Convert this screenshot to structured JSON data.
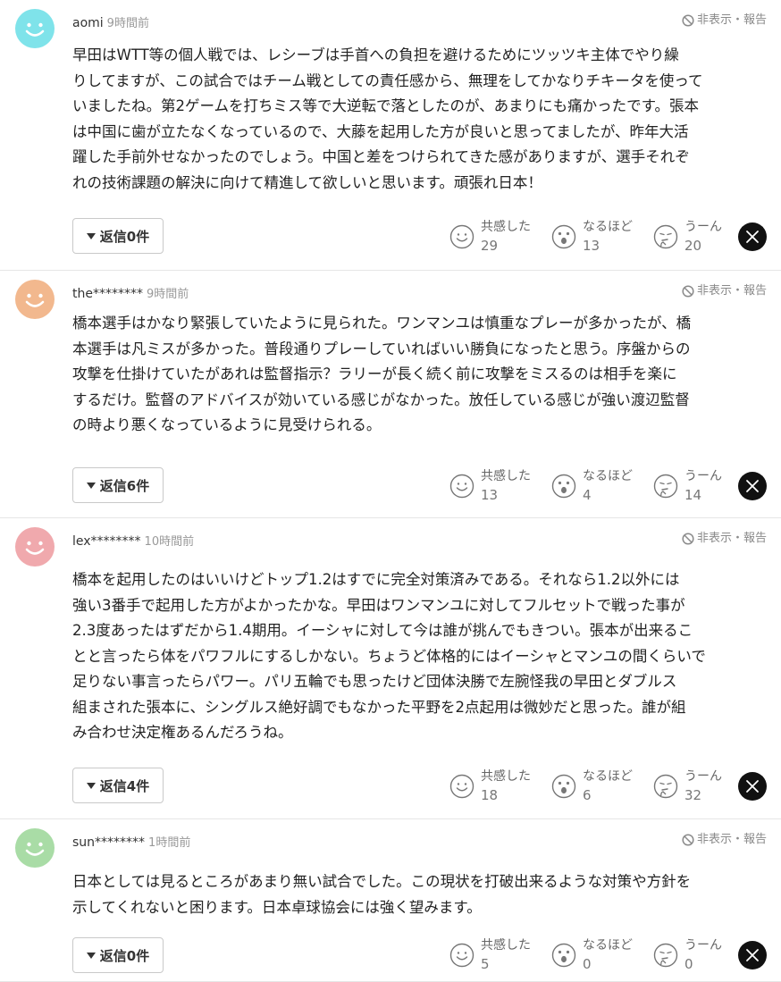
{
  "ui": {
    "hide_report": "非表示・報告",
    "reactions": {
      "empathy": "共感した",
      "insight": "なるほど",
      "hmm": "うーん"
    }
  },
  "colors": {
    "avatar_cyan": "#7fe3ea",
    "avatar_orange": "#f2b88e",
    "avatar_pink": "#f0a9ad",
    "avatar_green": "#a9dca6"
  },
  "comments": [
    {
      "avatar_color": "cyan",
      "name": "aomi",
      "time": "9時間前",
      "lines": [
        "早田はWTT等の個人戦では、レシーブは手首への負担を避けるためにツッツキ主体でやり繰",
        "りしてますが、この試合ではチーム戦としての責任感から、無理をしてかなりチキータを使って",
        "いましたね。第2ゲームを打ちミス等で大逆転で落としたのが、あまりにも痛かったです。張本",
        "は中国に歯が立たなくなっているので、大藤を起用した方が良いと思ってましたが、昨年大活",
        "躍した手前外せなかったのでしょう。中国と差をつけられてきた感がありますが、選手それぞ",
        "れの技術課題の解決に向けて精進して欲しいと思います。頑張れ日本！"
      ],
      "reply_label": "返信0件",
      "empathy": "29",
      "insight": "13",
      "hmm": "20"
    },
    {
      "avatar_color": "orange",
      "name": "the********",
      "time": "9時間前",
      "lines": [
        "橋本選手はかなり緊張していたように見られた。ワンマンユは慎重なプレーが多かったが、橋",
        "本選手は凡ミスが多かった。普段通りプレーしていればいい勝負になったと思う。序盤からの",
        "攻撃を仕掛けていたがあれは監督指示？ラリーが長く続く前に攻撃をミスるのは相手を楽に",
        "するだけ。監督のアドバイスが効いている感じがなかった。放任している感じが強い渡辺監督",
        "の時より悪くなっているように見受けられる。"
      ],
      "reply_label": "返信6件",
      "empathy": "13",
      "insight": "4",
      "hmm": "14"
    },
    {
      "avatar_color": "pink",
      "name": "lex********",
      "time": "10時間前",
      "lines": [
        "橋本を起用したのはいいけどトップ1.2はすでに完全対策済みである。それなら1.2以外には",
        "強い3番手で起用した方がよかったかな。早田はワンマンユに対してフルセットで戦った事が",
        "2.3度あったはずだから1.4期用。イーシャに対して今は誰が挑んでもきつい。張本が出来るこ",
        "とと言ったら体をパワフルにするしかない。ちょうど体格的にはイーシャとマンユの間くらいで",
        "足りない事言ったらパワー。パリ五輪でも思ったけど団体決勝で左腕怪我の早田とダブルス",
        "組まされた張本に、シングルス絶好調でもなかった平野を2点起用は微妙だと思った。誰が組",
        "み合わせ決定権あるんだろうね。"
      ],
      "reply_label": "返信4件",
      "empathy": "18",
      "insight": "6",
      "hmm": "32"
    },
    {
      "avatar_color": "green",
      "name": "sun********",
      "time": "1時間前",
      "lines": [
        "日本としては見るところがあまり無い試合でした。この現状を打破出来るような対策や方針を",
        "示してくれないと困ります。日本卓球協会には強く望みます。"
      ],
      "reply_label": "返信0件",
      "empathy": "5",
      "insight": "0",
      "hmm": "0"
    }
  ]
}
